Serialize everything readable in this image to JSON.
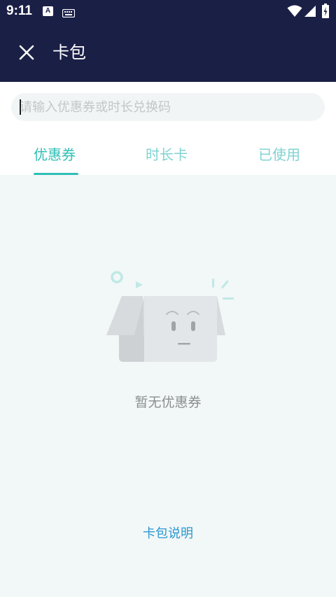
{
  "status_bar": {
    "time": "9:11",
    "notification_letter": "A",
    "icons": [
      "keyboard-icon",
      "wifi-icon",
      "signal-icon",
      "battery-icon"
    ]
  },
  "app_bar": {
    "title": "卡包",
    "close_icon": "close-icon"
  },
  "search": {
    "placeholder": "请输入优惠券或时长兑换码",
    "value": ""
  },
  "tabs": [
    {
      "label": "优惠券",
      "active": true
    },
    {
      "label": "时长卡",
      "active": false
    },
    {
      "label": "已使用",
      "active": false
    }
  ],
  "empty_state": {
    "illustration": "empty-box-icon",
    "text": "暂无优惠券"
  },
  "footer": {
    "help_link": "卡包说明"
  },
  "colors": {
    "header_bg": "#1a1f46",
    "accent": "#2fbfb7",
    "inactive_tab": "#7fd3d0",
    "link": "#2b98d0",
    "page_bg": "#f2f7f7"
  }
}
